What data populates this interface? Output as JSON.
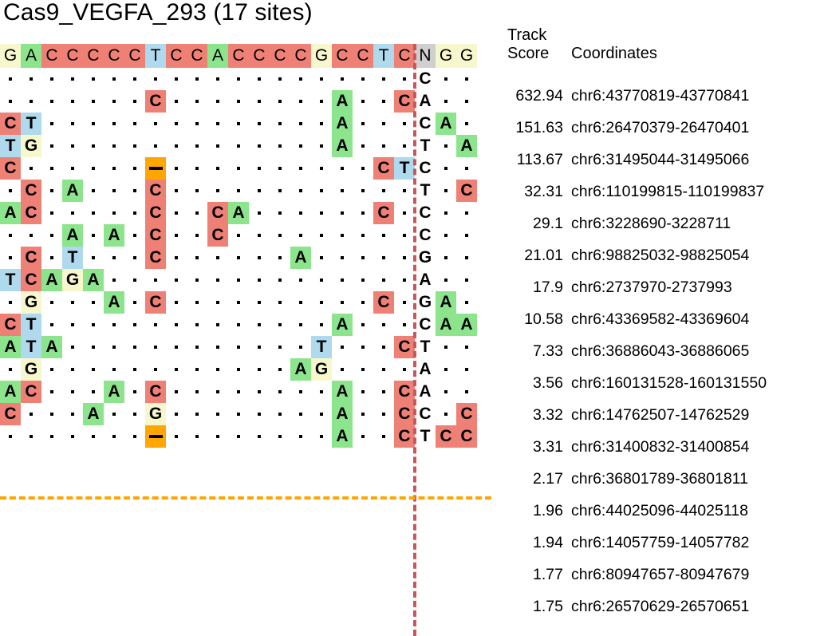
{
  "title": "Cas9_VEGFA_293 (17 sites)",
  "header": {
    "score_line1": "Track",
    "score_line2": "Score",
    "coordinates": "Coordinates"
  },
  "colors": {
    "A": "#8ce58c",
    "C": "#ef8076",
    "G": "#f7f7cd",
    "T": "#afd9ec",
    "N": "#cfcfcf",
    "gap": "#ffa600",
    "pam_divider": "#c9565a",
    "row_separator": "#ffa600"
  },
  "alignment": {
    "columns": 23,
    "pam_start_column": 21,
    "reference": {
      "label": "reference-sequence",
      "bases": [
        "G",
        "A",
        "C",
        "C",
        "C",
        "C",
        "C",
        "T",
        "C",
        "C",
        "A",
        "C",
        "C",
        "C",
        "C",
        "G",
        "C",
        "C",
        "T",
        "C",
        "N",
        "G",
        "G"
      ]
    },
    "rows": [
      {
        "score": "632.94",
        "coordinates": "chr6:43770819-43770841",
        "bases": [
          ".",
          ".",
          ".",
          ".",
          ".",
          ".",
          ".",
          ".",
          ".",
          ".",
          ".",
          ".",
          ".",
          ".",
          ".",
          ".",
          ".",
          ".",
          ".",
          ".",
          "C",
          ".",
          "."
        ]
      },
      {
        "score": "151.63",
        "coordinates": "chr6:26470379-26470401",
        "bases": [
          ".",
          ".",
          ".",
          ".",
          ".",
          ".",
          ".",
          "C",
          ".",
          ".",
          ".",
          ".",
          ".",
          ".",
          ".",
          ".",
          "A",
          ".",
          ".",
          "C",
          "A",
          ".",
          "."
        ]
      },
      {
        "score": "113.67",
        "coordinates": "chr6:31495044-31495066",
        "bases": [
          "C",
          "T",
          ".",
          ".",
          ".",
          ".",
          ".",
          ".",
          ".",
          ".",
          ".",
          ".",
          ".",
          ".",
          ".",
          ".",
          "A",
          ".",
          ".",
          ".",
          "C",
          "A",
          "."
        ]
      },
      {
        "score": "32.31",
        "coordinates": "chr6:110199815-110199837",
        "bases": [
          "T",
          "G",
          ".",
          ".",
          ".",
          ".",
          ".",
          ".",
          ".",
          ".",
          ".",
          ".",
          ".",
          ".",
          ".",
          ".",
          "A",
          ".",
          ".",
          ".",
          "T",
          ".",
          "A"
        ]
      },
      {
        "score": "29.1",
        "coordinates": "chr6:3228690-3228711",
        "bases": [
          "C",
          ".",
          ".",
          ".",
          ".",
          ".",
          ".",
          "-",
          ".",
          ".",
          ".",
          ".",
          ".",
          ".",
          ".",
          ".",
          ".",
          ".",
          "C",
          "T",
          "C",
          ".",
          "."
        ]
      },
      {
        "score": "21.01",
        "coordinates": "chr6:98825032-98825054",
        "bases": [
          ".",
          "C",
          ".",
          "A",
          ".",
          ".",
          ".",
          "C",
          ".",
          ".",
          ".",
          ".",
          ".",
          ".",
          ".",
          ".",
          ".",
          ".",
          ".",
          ".",
          "T",
          ".",
          "C"
        ]
      },
      {
        "score": "17.9",
        "coordinates": "chr6:2737970-2737993",
        "bases": [
          "A",
          "C",
          ".",
          ".",
          ".",
          ".",
          ".",
          "C",
          ".",
          ".",
          "C",
          "A",
          ".",
          ".",
          ".",
          ".",
          ".",
          ".",
          "C",
          ".",
          "C",
          ".",
          "."
        ]
      },
      {
        "score": "10.58",
        "coordinates": "chr6:43369582-43369604",
        "bases": [
          ".",
          ".",
          ".",
          "A",
          ".",
          "A",
          ".",
          "C",
          ".",
          ".",
          "C",
          ".",
          ".",
          ".",
          ".",
          ".",
          ".",
          ".",
          ".",
          ".",
          "C",
          ".",
          "."
        ]
      },
      {
        "score": "7.33",
        "coordinates": "chr6:36886043-36886065",
        "bases": [
          ".",
          "C",
          ".",
          "T",
          ".",
          ".",
          ".",
          "C",
          ".",
          ".",
          ".",
          ".",
          ".",
          ".",
          "A",
          ".",
          ".",
          ".",
          ".",
          ".",
          "G",
          ".",
          "."
        ]
      },
      {
        "score": "3.56",
        "coordinates": "chr6:160131528-160131550",
        "bases": [
          "T",
          "C",
          "A",
          "G",
          "A",
          ".",
          ".",
          ".",
          ".",
          ".",
          ".",
          ".",
          ".",
          ".",
          ".",
          ".",
          ".",
          ".",
          ".",
          ".",
          "A",
          ".",
          "."
        ]
      },
      {
        "score": "3.32",
        "coordinates": "chr6:14762507-14762529",
        "bases": [
          ".",
          "G",
          ".",
          ".",
          ".",
          "A",
          ".",
          "C",
          ".",
          ".",
          ".",
          ".",
          ".",
          ".",
          ".",
          ".",
          ".",
          ".",
          "C",
          ".",
          "G",
          "A",
          "."
        ]
      },
      {
        "score": "3.31",
        "coordinates": "chr6:31400832-31400854",
        "bases": [
          "C",
          "T",
          ".",
          ".",
          ".",
          ".",
          ".",
          ".",
          ".",
          ".",
          ".",
          ".",
          ".",
          ".",
          ".",
          ".",
          "A",
          ".",
          ".",
          ".",
          "C",
          "A",
          "A"
        ]
      },
      {
        "score": "2.17",
        "coordinates": "chr6:36801789-36801811",
        "bases": [
          "A",
          "T",
          "A",
          ".",
          ".",
          ".",
          ".",
          ".",
          ".",
          ".",
          ".",
          ".",
          ".",
          ".",
          ".",
          "T",
          ".",
          ".",
          ".",
          "C",
          "T",
          ".",
          "."
        ]
      },
      {
        "score": "1.96",
        "coordinates": "chr6:44025096-44025118",
        "bases": [
          ".",
          "G",
          ".",
          ".",
          ".",
          ".",
          ".",
          ".",
          ".",
          ".",
          ".",
          ".",
          ".",
          ".",
          "A",
          "G",
          ".",
          ".",
          ".",
          ".",
          "A",
          ".",
          "."
        ]
      },
      {
        "score": "1.94",
        "coordinates": "chr6:14057759-14057782",
        "bases": [
          "A",
          "C",
          ".",
          ".",
          ".",
          "A",
          ".",
          "C",
          ".",
          ".",
          ".",
          ".",
          ".",
          ".",
          ".",
          ".",
          "A",
          ".",
          ".",
          "C",
          "A",
          ".",
          "."
        ]
      },
      {
        "score": "1.77",
        "coordinates": "chr6:80947657-80947679",
        "bases": [
          "C",
          ".",
          ".",
          ".",
          "A",
          ".",
          ".",
          "G",
          ".",
          ".",
          ".",
          ".",
          ".",
          ".",
          ".",
          ".",
          "A",
          ".",
          ".",
          "C",
          "C",
          ".",
          "C"
        ]
      },
      {
        "score": "1.75",
        "coordinates": "chr6:26570629-26570651",
        "bases": [
          ".",
          ".",
          ".",
          ".",
          ".",
          ".",
          ".",
          "-",
          ".",
          ".",
          ".",
          ".",
          ".",
          ".",
          ".",
          ".",
          "A",
          ".",
          ".",
          "C",
          "T",
          "C",
          "C"
        ]
      }
    ],
    "separator_after_row_index": 12
  }
}
